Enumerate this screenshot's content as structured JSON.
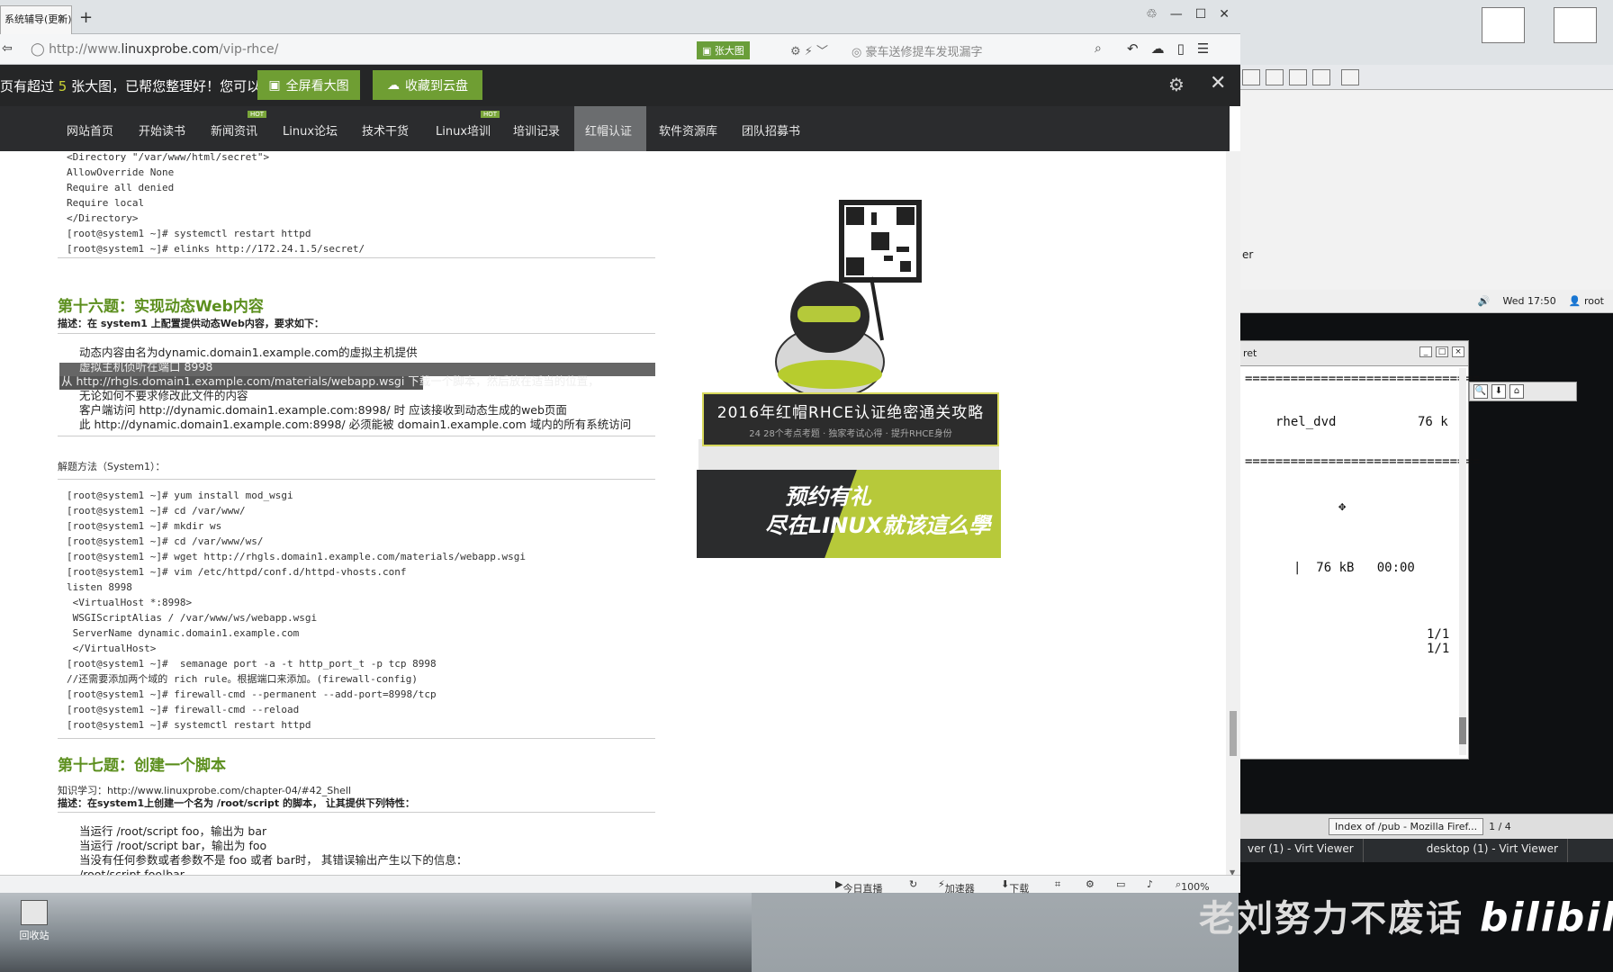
{
  "browser": {
    "tab_title": "系统辅导(更新)",
    "url_host": "http://www.",
    "url_domain": "linuxprobe.com",
    "url_path": "/vip-rhce/",
    "bigpic_label": "张大图",
    "search_text": "豪车送修提车发现漏字",
    "notice": {
      "prefix": "页有超过",
      "count": "5",
      "suffix": "张大图，已帮您整理好！您可以",
      "fullscreen_label": "全屏看大图",
      "save_label": "收藏到云盘"
    },
    "status": {
      "live": "今日直播",
      "accelerator": "加速器",
      "download": "下载",
      "zoom": "100%"
    }
  },
  "site": {
    "nav": [
      "网站首页",
      "开始读书",
      "新闻资讯",
      "Linux论坛",
      "技术干货",
      "Linux培训",
      "培训记录",
      "红帽认证",
      "软件资源库",
      "团队招募书"
    ],
    "nav_badges": {
      "news": "HOT",
      "training": "HOT"
    },
    "code_top": "<Directory \"/var/www/html/secret\">\nAllowOverride None\nRequire all denied\nRequire local\n</Directory>\n[root@system1 ~]# systemctl restart httpd\n[root@system1 ~]# elinks http://172.24.1.5/secret/",
    "q16": {
      "title": "第十六题：实现动态Web内容",
      "desc": "描述：在 system1 上配置提供动态Web内容，要求如下：",
      "reqs": [
        "动态内容由名为dynamic.domain1.example.com的虚拟主机提供",
        "虚拟主机侦听在端口 8998",
        "从 http://rhgls.domain1.example.com/materials/webapp.wsgi 下载一个脚本，然后放在适当的位置，",
        "无论如何不要求修改此文件的内容",
        "客户端访问 http://dynamic.domain1.example.com:8998/ 时 应该接收到动态生成的web页面",
        "此 http://dynamic.domain1.example.com:8998/ 必须能被 domain1.example.com 域内的所有系统访问"
      ],
      "method": "解题方法（System1）：",
      "code": "[root@system1 ~]# yum install mod_wsgi\n[root@system1 ~]# cd /var/www/\n[root@system1 ~]# mkdir ws\n[root@system1 ~]# cd /var/www/ws/\n[root@system1 ~]# wget http://rhgls.domain1.example.com/materials/webapp.wsgi\n[root@system1 ~]# vim /etc/httpd/conf.d/httpd-vhosts.conf\nlisten 8998\n <VirtualHost *:8998>\n WSGIScriptAlias / /var/www/ws/webapp.wsgi\n ServerName dynamic.domain1.example.com\n </VirtualHost>\n[root@system1 ~]#  semanage port -a -t http_port_t -p tcp 8998\n//还需要添加两个域的 rich rule。根据端口来添加。(firewall-config)\n[root@system1 ~]# firewall-cmd --permanent --add-port=8998/tcp\n[root@system1 ~]# firewall-cmd --reload\n[root@system1 ~]# systemctl restart httpd"
    },
    "q17": {
      "title": "第十七题：创建一个脚本",
      "ref": "知识学习：http://www.linuxprobe.com/chapter-04/#42_Shell",
      "desc": "描述：在system1上创建一个名为 /root/script 的脚本， 让其提供下列特性：",
      "reqs": [
        "当运行 /root/script foo，输出为 bar",
        "当运行 /root/script bar，输出为 foo",
        "当没有任何参数或者参数不是 foo 或者 bar时， 其错误输出产生以下的信息：",
        "/root/script foo|bar"
      ]
    },
    "poster": {
      "title": "2016年红帽RHCE认证绝密通关攻略",
      "subtitle": "24 28个考点考题 · 独家考试心得 · 提升RHCE身份",
      "slogan1": "预约有礼",
      "slogan2": "尽在LINUX就该這么學"
    }
  },
  "remote": {
    "panel_time": "Wed 17:50",
    "panel_user": "root",
    "left_label": "er",
    "vm_title": "ret",
    "term": {
      "repo_name": "rhel_dvd",
      "repo_size": "76 k",
      "progress": "|  76 kB   00:00",
      "count1": "1/1",
      "count2": "1/1"
    },
    "task_firefox": "Index of /pub - Mozilla Firef...",
    "pager": "1 / 4",
    "virt1": "ver (1) - Virt Viewer",
    "virt2": "desktop (1) - Virt Viewer",
    "watermark": "老刘努力不废话",
    "bilibili": "bilibili"
  },
  "desktop": {
    "icon_label": "回收站"
  }
}
